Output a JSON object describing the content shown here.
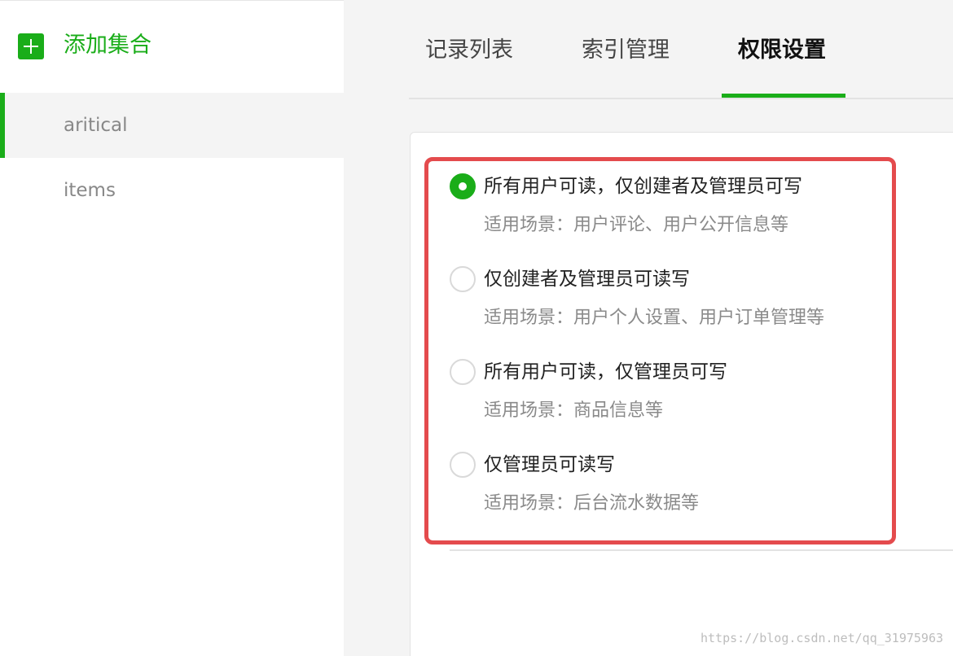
{
  "sidebar": {
    "add_label": "添加集合",
    "items": [
      {
        "label": "aritical",
        "active": true
      },
      {
        "label": "items",
        "active": false
      }
    ]
  },
  "tabs": [
    {
      "label": "记录列表",
      "active": false
    },
    {
      "label": "索引管理",
      "active": false
    },
    {
      "label": "权限设置",
      "active": true
    }
  ],
  "permissions": {
    "options": [
      {
        "title": "所有用户可读，仅创建者及管理员可写",
        "desc": "适用场景：用户评论、用户公开信息等",
        "checked": true
      },
      {
        "title": "仅创建者及管理员可读写",
        "desc": "适用场景：用户个人设置、用户订单管理等",
        "checked": false
      },
      {
        "title": "所有用户可读，仅管理员可写",
        "desc": "适用场景：商品信息等",
        "checked": false
      },
      {
        "title": "仅管理员可读写",
        "desc": "适用场景：后台流水数据等",
        "checked": false
      }
    ]
  },
  "watermark": "https://blog.csdn.net/qq_31975963",
  "colors": {
    "accent": "#1aad19",
    "highlight": "#e44b4d"
  },
  "icons": {
    "add": "plus-square-icon",
    "radio_checked": "radio-checked-icon",
    "radio_unchecked": "radio-unchecked-icon"
  }
}
